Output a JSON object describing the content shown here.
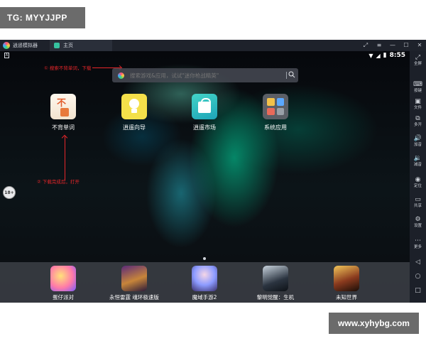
{
  "watermarks": {
    "top": "TG: MYYJJPP",
    "bottom": "www.xyhybg.com"
  },
  "titlebar": {
    "app_name": "逍遥模拟器",
    "tab_label": "主页",
    "controls": [
      "⤢",
      "≡",
      "—",
      "☐",
      "✕"
    ]
  },
  "status": {
    "time": "8:55",
    "wifi_icon": "▼",
    "signal_icon": "◢"
  },
  "search": {
    "placeholder": "搜索游戏&应用，试试\"迷你枪战精英\""
  },
  "annotations": {
    "step1": "① 搜索不背单词，下载",
    "step2": "② 下载完成后，打开"
  },
  "home_apps": [
    {
      "label": "不背单词"
    },
    {
      "label": "逍遥向导"
    },
    {
      "label": "逍遥市场"
    },
    {
      "label": "系统应用"
    }
  ],
  "side_badge": "18+",
  "dock_apps": [
    {
      "label": "蛋仔派对"
    },
    {
      "label": "永恒雷霆 魂环极速版"
    },
    {
      "label": "魔域手游2"
    },
    {
      "label": "黎明觉醒：生机"
    },
    {
      "label": "未知世界"
    }
  ],
  "sidebar": {
    "items": [
      {
        "glyph": "⤢",
        "label": "全屏"
      },
      {
        "glyph": "⌨",
        "label": "按键"
      },
      {
        "glyph": "▣",
        "label": "文件"
      },
      {
        "glyph": "⧉",
        "label": "多开"
      },
      {
        "glyph": "🔊",
        "label": "加音"
      },
      {
        "glyph": "🔉",
        "label": "减音"
      },
      {
        "glyph": "◉",
        "label": "定位"
      },
      {
        "glyph": "▭",
        "label": "共享"
      },
      {
        "glyph": "⚙",
        "label": "设置"
      },
      {
        "glyph": "⋯",
        "label": "更多"
      }
    ],
    "nav": [
      "◁",
      "○",
      "□"
    ]
  }
}
